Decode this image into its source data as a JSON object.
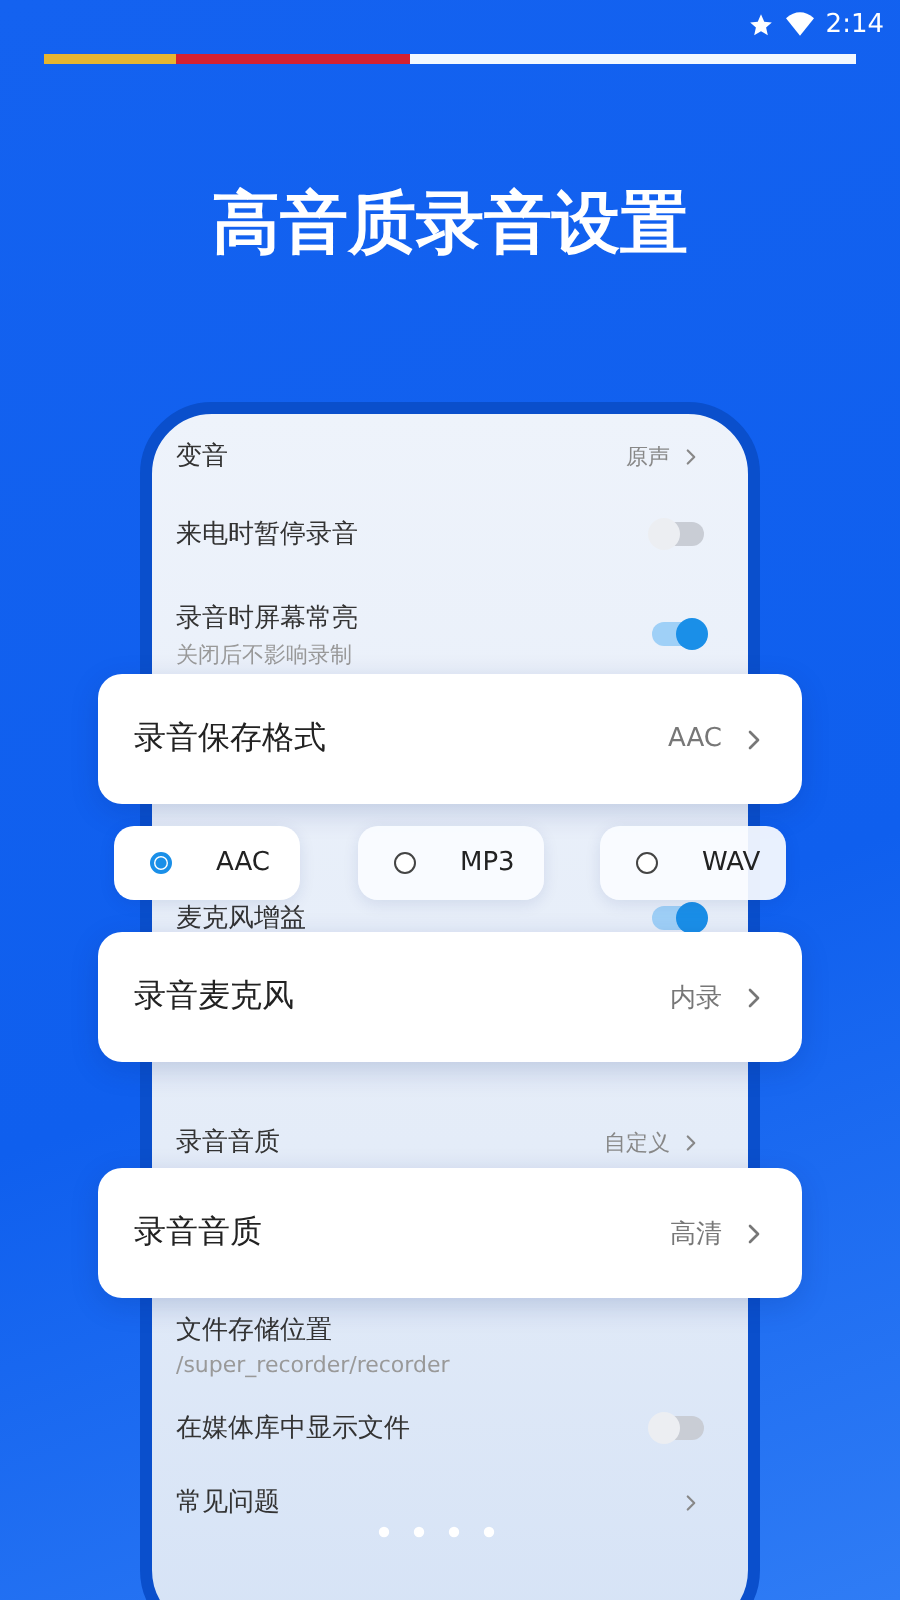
{
  "status_bar": {
    "time": "2:14"
  },
  "story_progress": {
    "level": 0.45
  },
  "title": "高音质录音设置",
  "phone_settings": [
    {
      "kind": "value",
      "label": "变音",
      "value": "原声"
    },
    {
      "kind": "toggle",
      "label": "来电时暂停录音",
      "on": false
    },
    {
      "kind": "toggle",
      "label": "录音时屏幕常亮",
      "subtitle": "关闭后不影响录制",
      "on": true
    },
    {
      "kind": "toggle",
      "label": "麦克风增益",
      "on": true
    },
    {
      "kind": "value",
      "label": "录音音质",
      "value": "自定义"
    },
    {
      "kind": "info",
      "label": "文件存储位置",
      "subtitle": "/super_recorder/recorder"
    },
    {
      "kind": "toggle",
      "label": "在媒体库中显示文件",
      "on": false
    },
    {
      "kind": "link",
      "label": "常见问题"
    }
  ],
  "cards": [
    {
      "label": "录音保存格式",
      "value": "AAC"
    },
    {
      "label": "录音麦克风",
      "value": "内录"
    },
    {
      "label": "录音音质",
      "value": "高清"
    }
  ],
  "format_options": [
    {
      "label": "AAC",
      "selected": true
    },
    {
      "label": "MP3",
      "selected": false
    },
    {
      "label": "WAV",
      "selected": false
    }
  ]
}
